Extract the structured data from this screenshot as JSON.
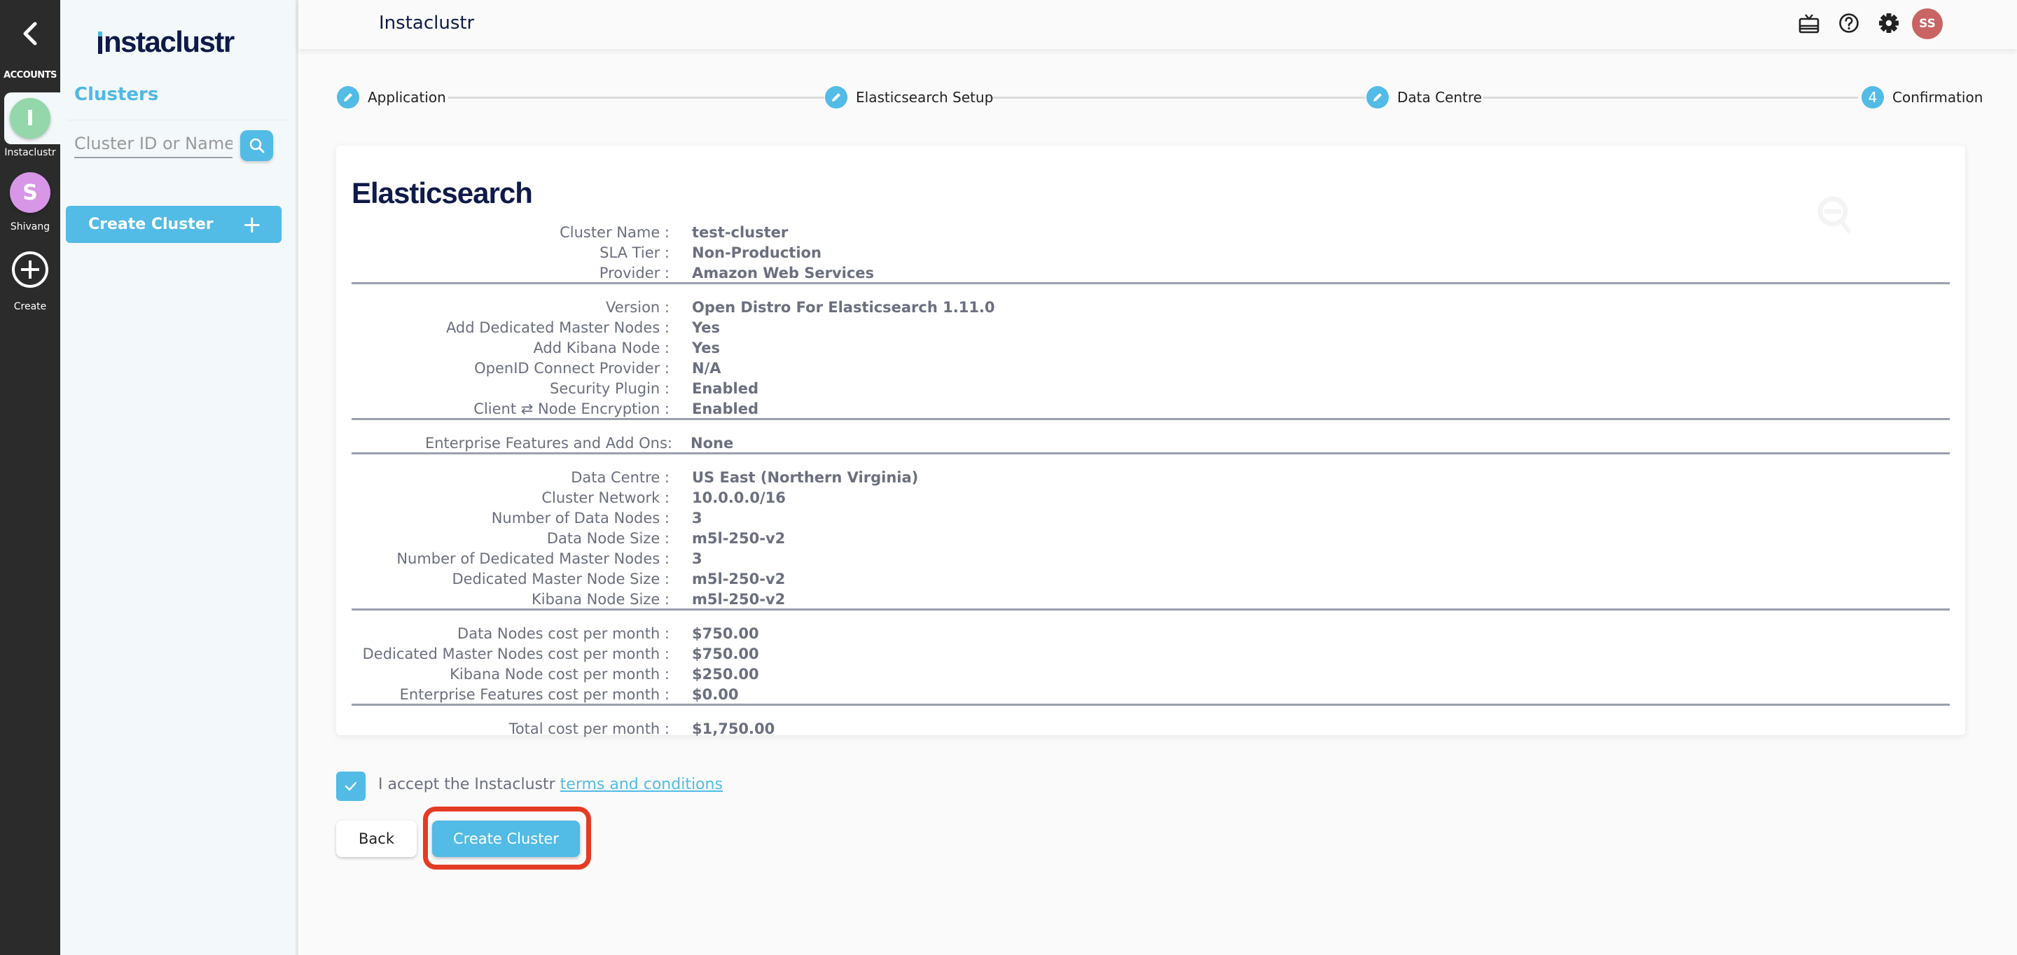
{
  "rail": {
    "accounts_label": "ACCOUNTS",
    "accounts": [
      {
        "initial": "I",
        "name": "Instaclustr",
        "color": "#93d7ab",
        "active": true
      },
      {
        "initial": "S",
        "name": "Shivang",
        "color": "#d796e6",
        "active": false
      }
    ],
    "create_label": "Create"
  },
  "sidebar": {
    "logo_text": "nstaclustr",
    "section_title": "Clusters",
    "search_placeholder": "Cluster ID or Name",
    "create_button_label": "Create Cluster",
    "create_button_icon": "+"
  },
  "header": {
    "title": "Instaclustr",
    "icons": [
      "gift-icon",
      "help-icon",
      "settings-icon"
    ],
    "user_initials": "SS"
  },
  "stepper": {
    "steps": [
      {
        "label": "Application",
        "state": "done",
        "icon": "pencil-icon"
      },
      {
        "label": "Elasticsearch Setup",
        "state": "done",
        "icon": "pencil-icon"
      },
      {
        "label": "Data Centre",
        "state": "done",
        "icon": "pencil-icon"
      },
      {
        "label": "Confirmation",
        "state": "current",
        "number": "4"
      }
    ]
  },
  "summary": {
    "title": "Elasticsearch",
    "groups": [
      [
        {
          "label": "Cluster Name :",
          "value": "test-cluster"
        },
        {
          "label": "SLA Tier :",
          "value": "Non-Production"
        },
        {
          "label": "Provider :",
          "value": "Amazon Web Services"
        }
      ],
      [
        {
          "label": "Version :",
          "value": "Open Distro For Elasticsearch 1.11.0"
        },
        {
          "label": "Add Dedicated Master Nodes :",
          "value": "Yes"
        },
        {
          "label": "Add Kibana Node :",
          "value": "Yes"
        },
        {
          "label": "OpenID Connect Provider :",
          "value": "N/A"
        },
        {
          "label": "Security Plugin :",
          "value": "Enabled"
        },
        {
          "label": "Client ⇄ Node Encryption :",
          "value": "Enabled"
        }
      ],
      [
        {
          "label": "Enterprise Features and Add Ons:",
          "value": "None"
        }
      ],
      [
        {
          "label": "Data Centre :",
          "value": "US East (Northern Virginia)"
        },
        {
          "label": "Cluster Network :",
          "value": "10.0.0.0/16"
        },
        {
          "label": "Number of Data Nodes :",
          "value": "3"
        },
        {
          "label": "Data Node Size :",
          "value": "m5l-250-v2"
        },
        {
          "label": "Number of Dedicated Master Nodes :",
          "value": "3"
        },
        {
          "label": "Dedicated Master Node Size :",
          "value": "m5l-250-v2"
        },
        {
          "label": "Kibana Node Size :",
          "value": "m5l-250-v2"
        }
      ],
      [
        {
          "label": "Data Nodes cost per month :",
          "value": "$750.00"
        },
        {
          "label": "Dedicated Master Nodes cost per month :",
          "value": "$750.00"
        },
        {
          "label": "Kibana Node cost per month :",
          "value": "$250.00"
        },
        {
          "label": "Enterprise Features cost per month :",
          "value": "$0.00"
        }
      ],
      [
        {
          "label": "Total cost per month :",
          "value": "$1,750.00"
        }
      ]
    ]
  },
  "terms": {
    "checked": true,
    "text": "I accept the Instaclustr ",
    "link_text": "terms and conditions"
  },
  "actions": {
    "back_label": "Back",
    "submit_label": "Create Cluster"
  },
  "colors": {
    "accent": "#52bbe6",
    "brand_navy": "#0f1a4a",
    "highlight": "#e43b25",
    "user_avatar": "#c96464"
  }
}
